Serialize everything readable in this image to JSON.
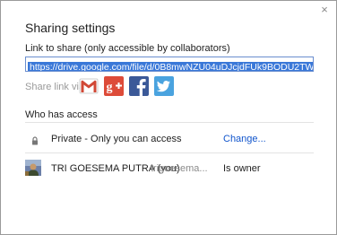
{
  "dialog": {
    "title": "Sharing settings",
    "close_glyph": "×"
  },
  "link": {
    "label": "Link to share (only accessible by collaborators)",
    "value": "https://drive.google.com/file/d/0B8mwNZU04uDJcjdFUk9BODU2TWM/edit?usp=sharing"
  },
  "share_via": {
    "label": "Share link via:",
    "services": [
      {
        "name": "gmail-icon",
        "color": "#d14836"
      },
      {
        "name": "google-plus-icon",
        "color": "#dd4b39"
      },
      {
        "name": "facebook-icon",
        "color": "#3b5998"
      },
      {
        "name": "twitter-icon",
        "color": "#4aa3df"
      }
    ]
  },
  "access": {
    "title": "Who has access",
    "private": {
      "text": "Private - Only you can access",
      "action": "Change..."
    },
    "owner": {
      "name": "TRI GOESEMA PUTRA (you)",
      "email": "trigoesema...",
      "role": "Is owner"
    }
  }
}
